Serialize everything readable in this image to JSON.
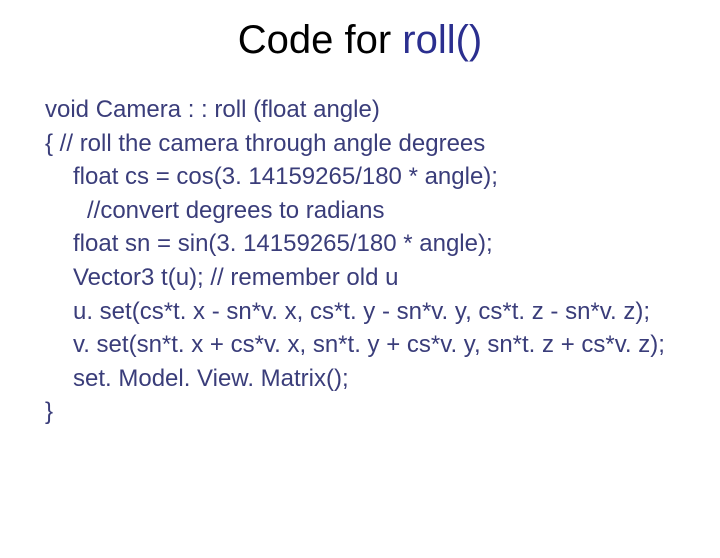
{
  "title_prefix": "Code for ",
  "title_emph": "roll()",
  "code": {
    "l1": "void Camera : : roll (float angle)",
    "l2": "{ // roll the camera through angle degrees",
    "l3": "float cs = cos(3. 14159265/180 * angle);",
    "l4": "//convert degrees to radians",
    "l5": "float sn = sin(3. 14159265/180 * angle);",
    "l6": "Vector3 t(u); // remember old u",
    "l7": "u. set(cs*t. x - sn*v. x, cs*t. y - sn*v. y, cs*t. z - sn*v. z);",
    "l8": "v. set(sn*t. x + cs*v. x, sn*t. y + cs*v. y, sn*t. z + cs*v. z);",
    "l9": "set. Model. View. Matrix();",
    "l10": "}"
  }
}
